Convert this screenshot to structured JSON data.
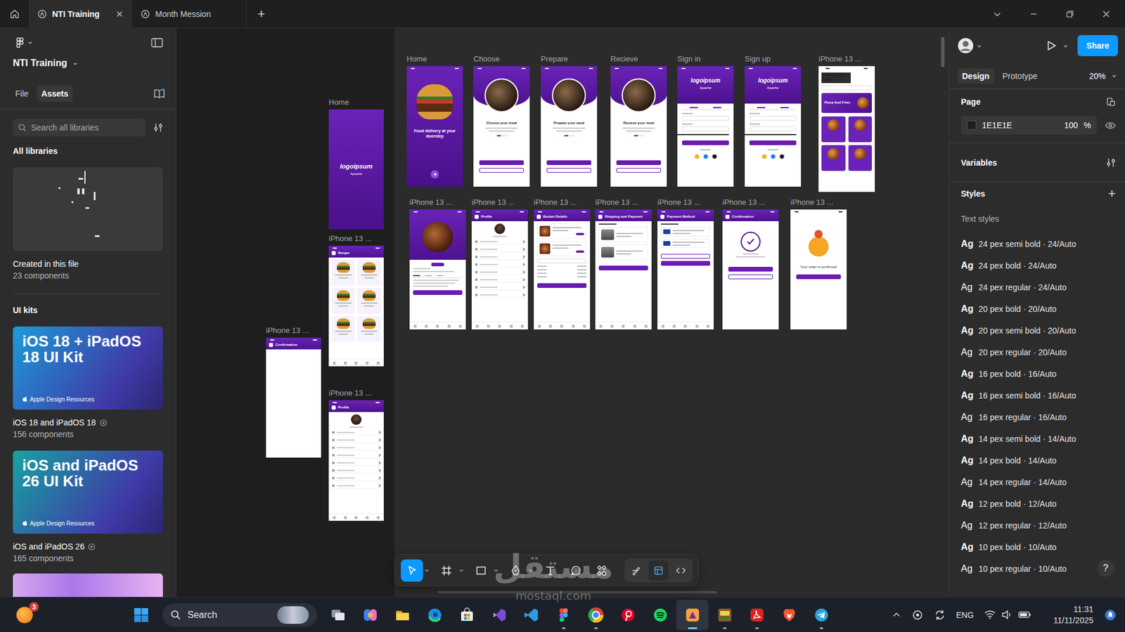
{
  "titlebar": {
    "tabs": [
      {
        "label": "NTI Training",
        "selected": true
      },
      {
        "label": "Month Mession",
        "selected": false
      }
    ],
    "new_tab": "+"
  },
  "left_panel": {
    "file_name": "NTI Training",
    "tabs": [
      {
        "label": "File",
        "selected": false
      },
      {
        "label": "Assets",
        "selected": true
      }
    ],
    "search": {
      "placeholder": "Search all libraries"
    },
    "libraries_heading": "All libraries",
    "local_library": {
      "title": "Created in this file",
      "count": "23 components"
    },
    "kits_heading": "UI kits",
    "kits": [
      {
        "cover_title": "iOS 18 + iPadOS 18 UI Kit",
        "cover_brand": "Apple Design Resources",
        "title": "iOS 18 and iPadOS 18",
        "count": "156 components",
        "color": "#1d9bd8"
      },
      {
        "cover_title": "iOS and iPadOS 26 UI Kit",
        "cover_brand": "Apple Design Resources",
        "title": "iOS and iPadOS 26",
        "count": "165 components",
        "color": "#18a3a0"
      }
    ]
  },
  "canvas": {
    "frames": [
      {
        "label": "Home",
        "kind": "hero",
        "title": "Food delivery at your doorstep"
      },
      {
        "label": "Choose",
        "kind": "onboard",
        "title": "Choose your meal"
      },
      {
        "label": "Prepare",
        "kind": "onboard",
        "title": "Prepare your meal"
      },
      {
        "label": "Recieve",
        "kind": "onboard",
        "title": "Recieve your meal"
      },
      {
        "label": "Sign in",
        "kind": "auth",
        "title": "logoipsum",
        "sub": "Apache"
      },
      {
        "label": "Sign up",
        "kind": "auth",
        "title": "logoipsum",
        "sub": "Apache"
      },
      {
        "label": "iPhone 13 ...",
        "kind": "menu",
        "title": "what are you eat?!",
        "sub": "Pizza And Fries"
      },
      {
        "label": "iPhone 13 ...",
        "kind": "detail"
      },
      {
        "label": "iPhone 13 ...",
        "kind": "profile",
        "title": "Profile"
      },
      {
        "label": "iPhone 13 ...",
        "kind": "basket",
        "title": "Basket Details"
      },
      {
        "label": "iPhone 13 ...",
        "kind": "shipping",
        "title": "Shipping and Payment"
      },
      {
        "label": "iPhone 13 ...",
        "kind": "payment",
        "title": "Payment Method"
      },
      {
        "label": "iPhone 13 ...",
        "kind": "confirm",
        "title": "Confirmation"
      },
      {
        "label": "iPhone 13 ...",
        "kind": "delivery",
        "title": "Your order is confirmed"
      },
      {
        "label": "Home",
        "kind": "splash",
        "title": "logoipsum",
        "sub": "Apache"
      },
      {
        "label": "iPhone 13 ...",
        "kind": "grid",
        "title": "Burger"
      },
      {
        "label": "iPhone 13 ...",
        "kind": "profile",
        "title": "Profile"
      },
      {
        "label": "iPhone 13 ...",
        "kind": "blank",
        "title": "Confirmation"
      }
    ],
    "toolbar": {
      "tools": [
        {
          "kind": "move",
          "selected": true,
          "menu": true
        },
        {
          "kind": "frame",
          "selected": false,
          "menu": true
        },
        {
          "kind": "shape",
          "selected": false,
          "menu": true
        },
        {
          "kind": "pen",
          "selected": false,
          "menu": true
        },
        {
          "kind": "text",
          "selected": false,
          "menu": false
        },
        {
          "kind": "comment",
          "selected": false,
          "menu": false
        },
        {
          "kind": "actions",
          "selected": false,
          "menu": false
        }
      ],
      "modes": [
        {
          "kind": "draw",
          "selected": false
        },
        {
          "kind": "design",
          "selected": true
        },
        {
          "kind": "dev",
          "selected": false
        }
      ]
    }
  },
  "right_panel": {
    "share": "Share",
    "tabs": [
      {
        "label": "Design",
        "selected": true
      },
      {
        "label": "Prototype",
        "selected": false
      }
    ],
    "zoom": "20%",
    "page": {
      "heading": "Page",
      "color_hex": "1E1E1E",
      "opacity": "100",
      "unit": "%"
    },
    "variables": "Variables",
    "styles": "Styles",
    "add": "+",
    "text_styles_heading": "Text styles",
    "text_styles": [
      {
        "sample": "Ag",
        "label": "24 pex semi bold · 24/Auto",
        "weight": "semibold"
      },
      {
        "sample": "Ag",
        "label": "24 pex bold · 24/Auto",
        "weight": "bold"
      },
      {
        "sample": "Ag",
        "label": "24 pex regular · 24/Auto",
        "weight": "regular"
      },
      {
        "sample": "Ag",
        "label": "20 pex bold · 20/Auto",
        "weight": "bold"
      },
      {
        "sample": "Ag",
        "label": "20 pex semi bold · 20/Auto",
        "weight": "semibold"
      },
      {
        "sample": "Ag",
        "label": "20 pex regular · 20/Auto",
        "weight": "regular"
      },
      {
        "sample": "Ag",
        "label": "16 pex bold · 16/Auto",
        "weight": "bold"
      },
      {
        "sample": "Ag",
        "label": "16 pex semi bold · 16/Auto",
        "weight": "semibold"
      },
      {
        "sample": "Ag",
        "label": "16 pex regular · 16/Auto",
        "weight": "regular"
      },
      {
        "sample": "Ag",
        "label": "14 pex semi bold · 14/Auto",
        "weight": "semibold"
      },
      {
        "sample": "Ag",
        "label": "14 pex bold · 14/Auto",
        "weight": "bold"
      },
      {
        "sample": "Ag",
        "label": "14 pex regular · 14/Auto",
        "weight": "regular"
      },
      {
        "sample": "Ag",
        "label": "12 pex bold · 12/Auto",
        "weight": "bold"
      },
      {
        "sample": "Ag",
        "label": "12 pex regular · 12/Auto",
        "weight": "regular"
      },
      {
        "sample": "Ag",
        "label": "10 pex bold · 10/Auto",
        "weight": "bold"
      },
      {
        "sample": "Ag",
        "label": "10 pex regular · 10/Auto",
        "weight": "regular"
      }
    ],
    "help": "?"
  },
  "taskbar": {
    "notification_badge": "3",
    "search": "Search",
    "apps": [
      {
        "kind": "taskview",
        "running": false,
        "active": false
      },
      {
        "kind": "copilot",
        "running": false,
        "active": false
      },
      {
        "kind": "explorer",
        "running": false,
        "active": false
      },
      {
        "kind": "edge",
        "running": false,
        "active": false
      },
      {
        "kind": "store",
        "running": false,
        "active": false
      },
      {
        "kind": "vs",
        "running": false,
        "active": false
      },
      {
        "kind": "vscode",
        "running": false,
        "active": false
      },
      {
        "kind": "figma",
        "running": true,
        "active": false
      },
      {
        "kind": "chrome",
        "running": true,
        "active": false
      },
      {
        "kind": "pinterest",
        "running": false,
        "active": false
      },
      {
        "kind": "spotify",
        "running": false,
        "active": false
      },
      {
        "kind": "design",
        "running": true,
        "active": true
      },
      {
        "kind": "game",
        "running": true,
        "active": false
      },
      {
        "kind": "acrobat",
        "running": true,
        "active": false
      },
      {
        "kind": "brave",
        "running": false,
        "active": false
      },
      {
        "kind": "telegram",
        "running": true,
        "active": false
      }
    ],
    "tray": {
      "language": "ENG",
      "time": "11:31",
      "date": "11/11/2025"
    }
  },
  "watermark": {
    "arabic": "مستقل",
    "latin": "mostaql.com"
  }
}
